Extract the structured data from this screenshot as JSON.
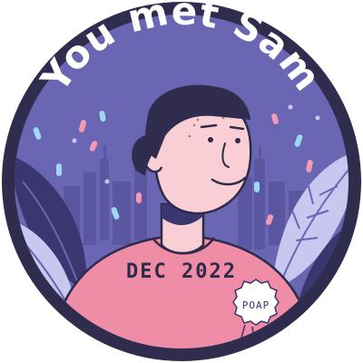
{
  "badge": {
    "title": "You met Sam",
    "shirt_text": "DEC  2022",
    "logo_text": "POAP"
  },
  "colors": {
    "outer_ring": "#2f2c4e",
    "sky": "#6a66b3",
    "skyline": "#544f97",
    "leaf_light": "#c8c7ef",
    "leaf_dark": "#3a3670",
    "shirt": "#ef8ca6",
    "skin": "#f9cfd5",
    "cap": "#2f2c4e",
    "ink": "#2e2a4a"
  },
  "icons": {
    "logo": "poap-badge-icon",
    "person": "person-illustration"
  }
}
